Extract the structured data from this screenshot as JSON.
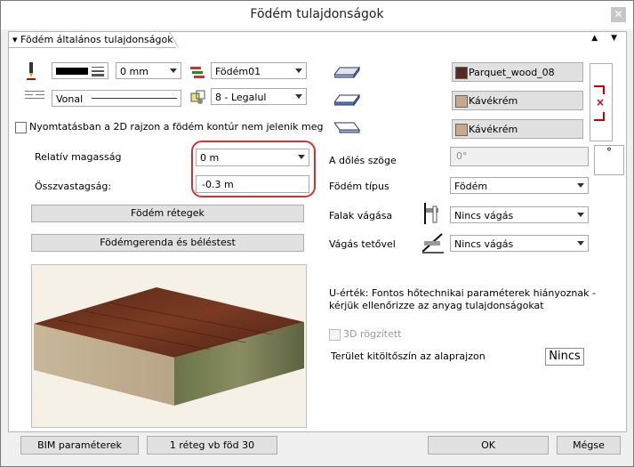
{
  "window": {
    "title": "Födém tulajdonságok",
    "close_glyph": "✕"
  },
  "section": {
    "title": "Födém általános tulajdonságok"
  },
  "panel_controls": {
    "arrows": "▲ ▼"
  },
  "pen": {
    "color": "#000000",
    "thickness": "0 mm",
    "layer": "Födém01"
  },
  "line": {
    "type": "Vonal",
    "order": "8 - Legalul"
  },
  "checkbox_contour": {
    "label": "Nyomtatásban a 2D rajzon a födém kontúr nem jelenik meg",
    "checked": false
  },
  "materials": [
    {
      "name": "Parquet_wood_08",
      "color": "#5a2a1e"
    },
    {
      "name": "Kávékrém",
      "color": "#c8a98a"
    },
    {
      "name": "Kávékrém",
      "color": "#c8a98a"
    }
  ],
  "reset_material_icon": "×",
  "relative_height": {
    "label": "Relatív magasság",
    "value": "0 m"
  },
  "thickness": {
    "label": "Összvastagság:",
    "value": "-0.3 m"
  },
  "buttons": {
    "layers": "Födém rétegek",
    "beams": "Födémgerenda és béléstest"
  },
  "slope": {
    "label": "A dőlés szöge",
    "value": "0°",
    "button": "°"
  },
  "slab_type": {
    "label": "Födém típus",
    "value": "Födém"
  },
  "wall_cut": {
    "label": "Falak vágása",
    "value": "Nincs vágás"
  },
  "roof_cut": {
    "label": "Vágás tetővel",
    "value": "Nincs vágás"
  },
  "u_value_note": "U-érték: Fontos hőtechnikai paraméterek hiányoznak - kérjük ellenőrizze az anyag tulajdonságokat",
  "fixed_3d": {
    "label": "3D rögzített",
    "checked": false
  },
  "fill": {
    "label": "Terület kitöltőszín az alaprajzon",
    "value": "Nincs"
  },
  "footer": {
    "bim": "BIM paraméterek",
    "layer_info": "1 réteg vb föd 30",
    "ok": "OK",
    "cancel": "Mégse"
  }
}
